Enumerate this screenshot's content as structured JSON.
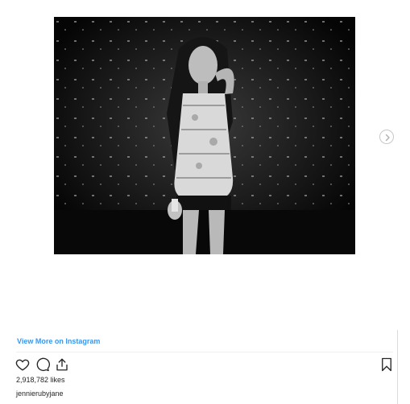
{
  "embed": {
    "view_more_label": "View More on Instagram",
    "likes_text": "2,918,782 likes",
    "username": "jennierubyjane"
  },
  "icons": {
    "like": "heart-icon",
    "comment": "comment-icon",
    "share": "share-icon",
    "save": "bookmark-icon",
    "next": "chevron-right-icon"
  },
  "colors": {
    "link": "#3897f0",
    "text": "#262626",
    "divider": "#efefef"
  }
}
